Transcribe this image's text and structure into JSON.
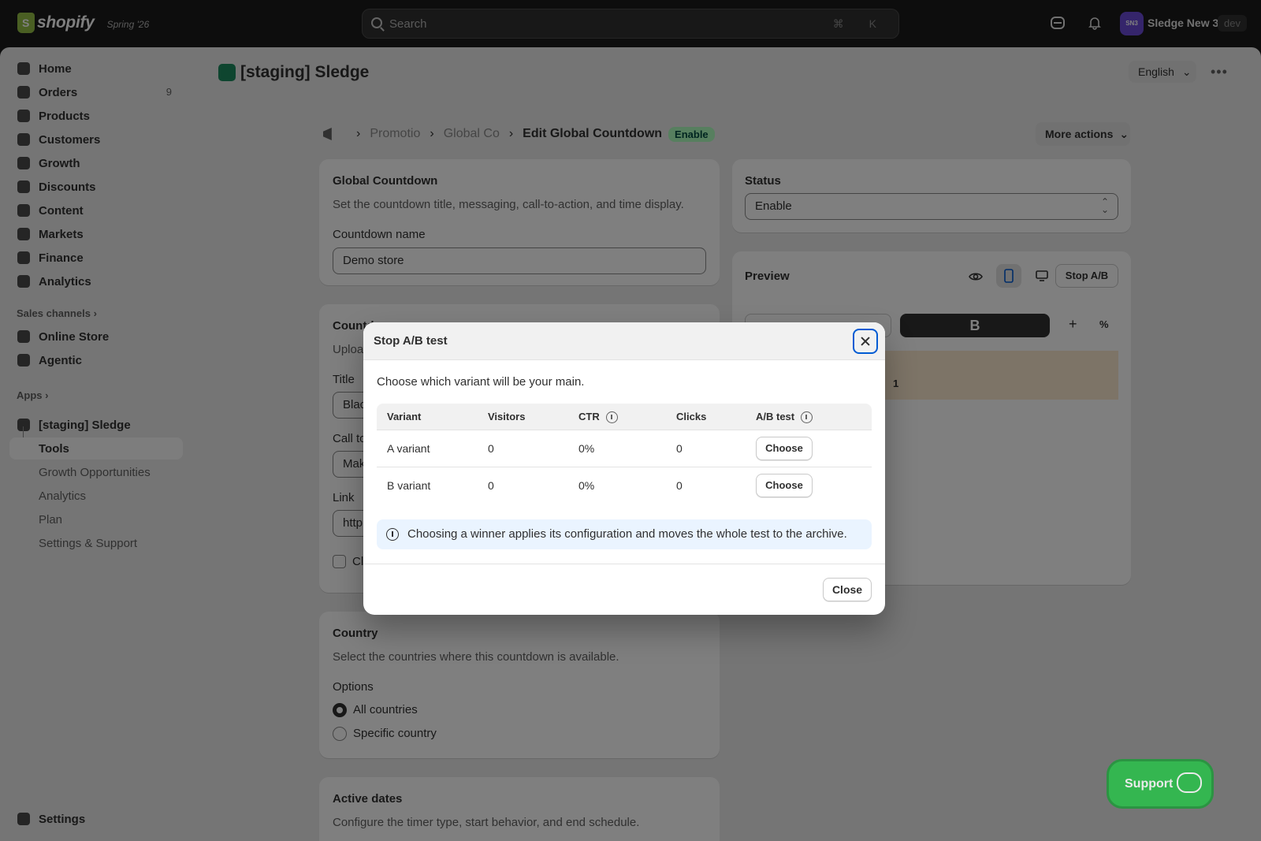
{
  "topbar": {
    "logo_text": "shopify",
    "edition": "Spring '26",
    "search_placeholder": "Search",
    "search_shortcut": "⌘ K",
    "store_initials": "SN3",
    "store_name": "Sledge New 3",
    "store_badge": "dev"
  },
  "sidebar": {
    "items": [
      {
        "label": "Home",
        "icon": "home-icon"
      },
      {
        "label": "Orders",
        "icon": "orders-icon",
        "badge": "9"
      },
      {
        "label": "Products",
        "icon": "tag-icon"
      },
      {
        "label": "Customers",
        "icon": "person-icon"
      },
      {
        "label": "Growth",
        "icon": "growth-icon"
      },
      {
        "label": "Discounts",
        "icon": "discount-icon"
      },
      {
        "label": "Content",
        "icon": "content-icon"
      },
      {
        "label": "Markets",
        "icon": "globe-icon"
      },
      {
        "label": "Finance",
        "icon": "bank-icon"
      },
      {
        "label": "Analytics",
        "icon": "chart-icon"
      }
    ],
    "sales_channels_label": "Sales channels",
    "channels": [
      {
        "label": "Online Store",
        "icon": "store-icon"
      },
      {
        "label": "Agentic",
        "icon": "agentic-icon"
      }
    ],
    "apps_label": "Apps",
    "app_name": "[staging] Sledge",
    "app_sub": [
      "Tools",
      "Growth Opportunities",
      "Analytics",
      "Plan",
      "Settings & Support"
    ],
    "settings_label": "Settings"
  },
  "page": {
    "title": "[staging] Sledge",
    "language": "English",
    "breadcrumb": [
      "Promotio",
      "Global Co"
    ],
    "current": "Edit Global Countdown",
    "status_badge": "Enable",
    "more_actions": "More actions"
  },
  "global_card": {
    "title": "Global Countdown",
    "desc": "Set the countdown title, messaging, call-to-action, and time display.",
    "name_label": "Countdown name",
    "name_value": "Demo store"
  },
  "content_card": {
    "title": "Countd",
    "desc": "Uploa",
    "title_label": "Title",
    "title_value": "Blac",
    "cta_label": "Call to",
    "cta_value": "Mak",
    "link_label": "Link",
    "link_value": "http",
    "checkbox_label": "Cl"
  },
  "country_card": {
    "title": "Country",
    "desc": "Select the countries where this countdown is available.",
    "options_label": "Options",
    "options": [
      "All countries",
      "Specific country"
    ]
  },
  "dates_card": {
    "title": "Active dates",
    "desc": "Configure the timer type, start behavior, and end schedule."
  },
  "status_card": {
    "title": "Status",
    "value": "Enable"
  },
  "preview_card": {
    "title": "Preview",
    "stop_ab": "Stop A/B",
    "variant_b": "B",
    "add": "+",
    "percent": "%",
    "preview_snippet": "1"
  },
  "modal": {
    "title": "Stop A/B test",
    "intro": "Choose which variant will be your main.",
    "columns": [
      "Variant",
      "Visitors",
      "CTR",
      "Clicks",
      "A/B test"
    ],
    "rows": [
      {
        "variant": "A variant",
        "visitors": "0",
        "ctr": "0%",
        "clicks": "0",
        "action": "Choose"
      },
      {
        "variant": "B variant",
        "visitors": "0",
        "ctr": "0%",
        "clicks": "0",
        "action": "Choose"
      }
    ],
    "banner": "Choosing a winner applies its configuration and moves the whole test to the archive.",
    "close": "Close"
  },
  "support": {
    "label": "Support"
  },
  "colors": {
    "accent": "#005bd3",
    "status_bg": "#affebf",
    "support": "#29c24a",
    "banner_bg": "#eaf4ff"
  }
}
